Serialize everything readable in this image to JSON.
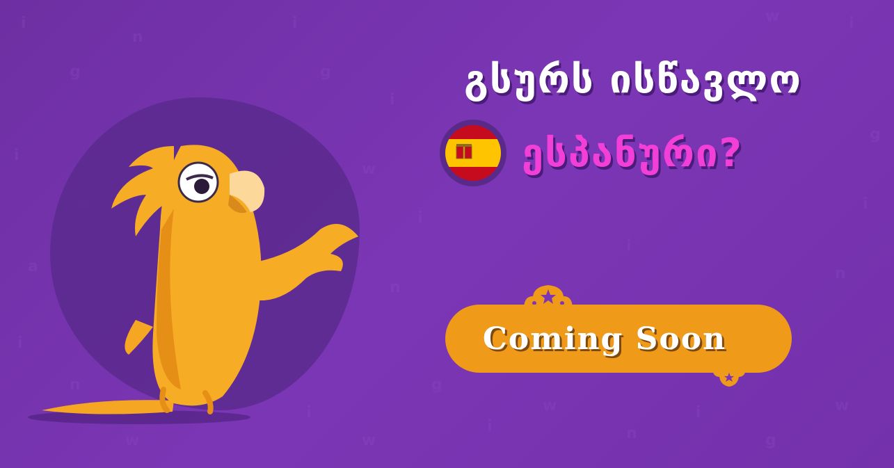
{
  "headline": "გსურს ისწავლო",
  "language": "ესპანური?",
  "cta": {
    "label": "Coming Soon"
  },
  "colors": {
    "background": "#7b36b5",
    "accent_pink": "#f23fd7",
    "button": "#f09a1a",
    "parrot": "#f5a623"
  },
  "icons": {
    "flag": "spain-flag-icon",
    "mascot": "parrot-mascot",
    "ornament": "star-ornament-icon"
  }
}
